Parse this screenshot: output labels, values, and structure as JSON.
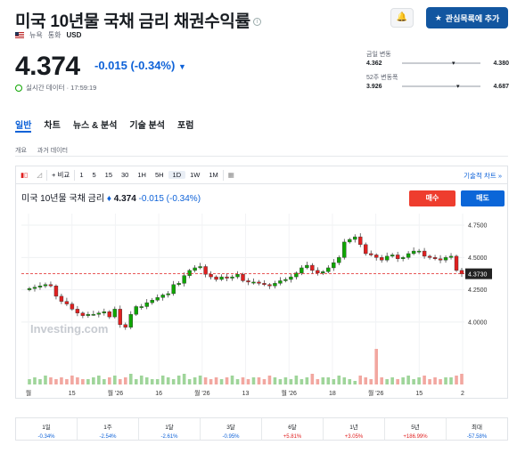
{
  "header": {
    "title": "미국 10년물 국채 금리 채권수익률",
    "meta_news": "뉴욕",
    "meta_currency_label": "통화",
    "meta_currency": "USD",
    "watchlist_label": "관심목록에 추가"
  },
  "quote": {
    "price": "4.374",
    "change": "-0.015 (-0.34%)",
    "realtime": "실시간 데이터 · 17:59:19"
  },
  "ranges": [
    {
      "label": "금일 변동",
      "low": "4.362",
      "high": "4.380"
    },
    {
      "label": "52주 변동폭",
      "low": "3.926",
      "high": "4.687"
    }
  ],
  "tabs": [
    "일반",
    "차트",
    "뉴스 & 분석",
    "기술 분석",
    "포럼"
  ],
  "subtabs": [
    "개요",
    "과거 데이터"
  ],
  "toolbar": {
    "compare": "+ 비교",
    "intervals": [
      "1",
      "5",
      "15",
      "30",
      "1H",
      "5H",
      "1D",
      "1W",
      "1M"
    ],
    "selected": "1D",
    "tech_chart": "기술적 차트 »"
  },
  "chart_header": {
    "name": "미국 10년물 국채 금리",
    "value": "4.374",
    "change": "-0.015 (-0.34%)",
    "sell": "매수",
    "buy": "매도"
  },
  "chart_data": {
    "type": "candlestick",
    "y_ticks": [
      "4.7500",
      "4.5000",
      "4.2500",
      "4.0000"
    ],
    "last_label": "4.3730",
    "x_ticks": [
      "월",
      "15",
      "월 '26",
      "16",
      "월 '26",
      "13",
      "월 '26",
      "18",
      "월 '26",
      "15",
      "2"
    ],
    "ylim": [
      3.82,
      4.84
    ],
    "closes": [
      4.26,
      4.27,
      4.28,
      4.29,
      4.28,
      4.2,
      4.16,
      4.14,
      4.1,
      4.07,
      4.05,
      4.06,
      4.06,
      4.07,
      4.08,
      4.04,
      4.1,
      3.98,
      3.96,
      4.06,
      4.12,
      4.12,
      4.15,
      4.17,
      4.19,
      4.21,
      4.22,
      4.29,
      4.3,
      4.36,
      4.4,
      4.42,
      4.43,
      4.37,
      4.35,
      4.33,
      4.35,
      4.34,
      4.35,
      4.37,
      4.32,
      4.31,
      4.31,
      4.3,
      4.29,
      4.28,
      4.3,
      4.32,
      4.33,
      4.35,
      4.38,
      4.42,
      4.44,
      4.4,
      4.38,
      4.39,
      4.42,
      4.46,
      4.5,
      4.62,
      4.64,
      4.66,
      4.6,
      4.53,
      4.52,
      4.5,
      4.48,
      4.51,
      4.52,
      4.49,
      4.5,
      4.53,
      4.55,
      4.55,
      4.51,
      4.5,
      4.49,
      4.48,
      4.5,
      4.51,
      4.4,
      4.374
    ],
    "volumes": [
      3,
      4,
      3,
      5,
      4,
      3,
      4,
      3,
      5,
      4,
      3,
      3,
      4,
      5,
      3,
      4,
      5,
      3,
      4,
      6,
      3,
      5,
      4,
      3,
      3,
      5,
      4,
      3,
      5,
      6,
      3,
      4,
      5,
      4,
      3,
      4,
      3,
      4,
      5,
      3,
      4,
      3,
      4,
      4,
      3,
      5,
      4,
      3,
      4,
      3,
      5,
      3,
      4,
      6,
      3,
      4,
      4,
      3,
      5,
      4,
      3,
      2,
      5,
      4,
      3,
      20,
      4,
      3,
      4,
      3,
      4,
      5,
      3,
      4,
      5,
      3,
      4,
      3,
      4,
      4,
      5,
      6
    ]
  },
  "performance": [
    {
      "label": "1일",
      "value": "-0.34%"
    },
    {
      "label": "1주",
      "value": "-2.54%"
    },
    {
      "label": "1달",
      "value": "-2.61%"
    },
    {
      "label": "3달",
      "value": "-0.95%"
    },
    {
      "label": "6달",
      "value": "+5.81%"
    },
    {
      "label": "1년",
      "value": "+3.05%"
    },
    {
      "label": "5년",
      "value": "+186.99%"
    },
    {
      "label": "최대",
      "value": "-57.58%"
    }
  ],
  "watermark": "Investing.com",
  "colors": {
    "up": "#0ea600",
    "down": "#e02020",
    "accent": "#0e62d8"
  }
}
